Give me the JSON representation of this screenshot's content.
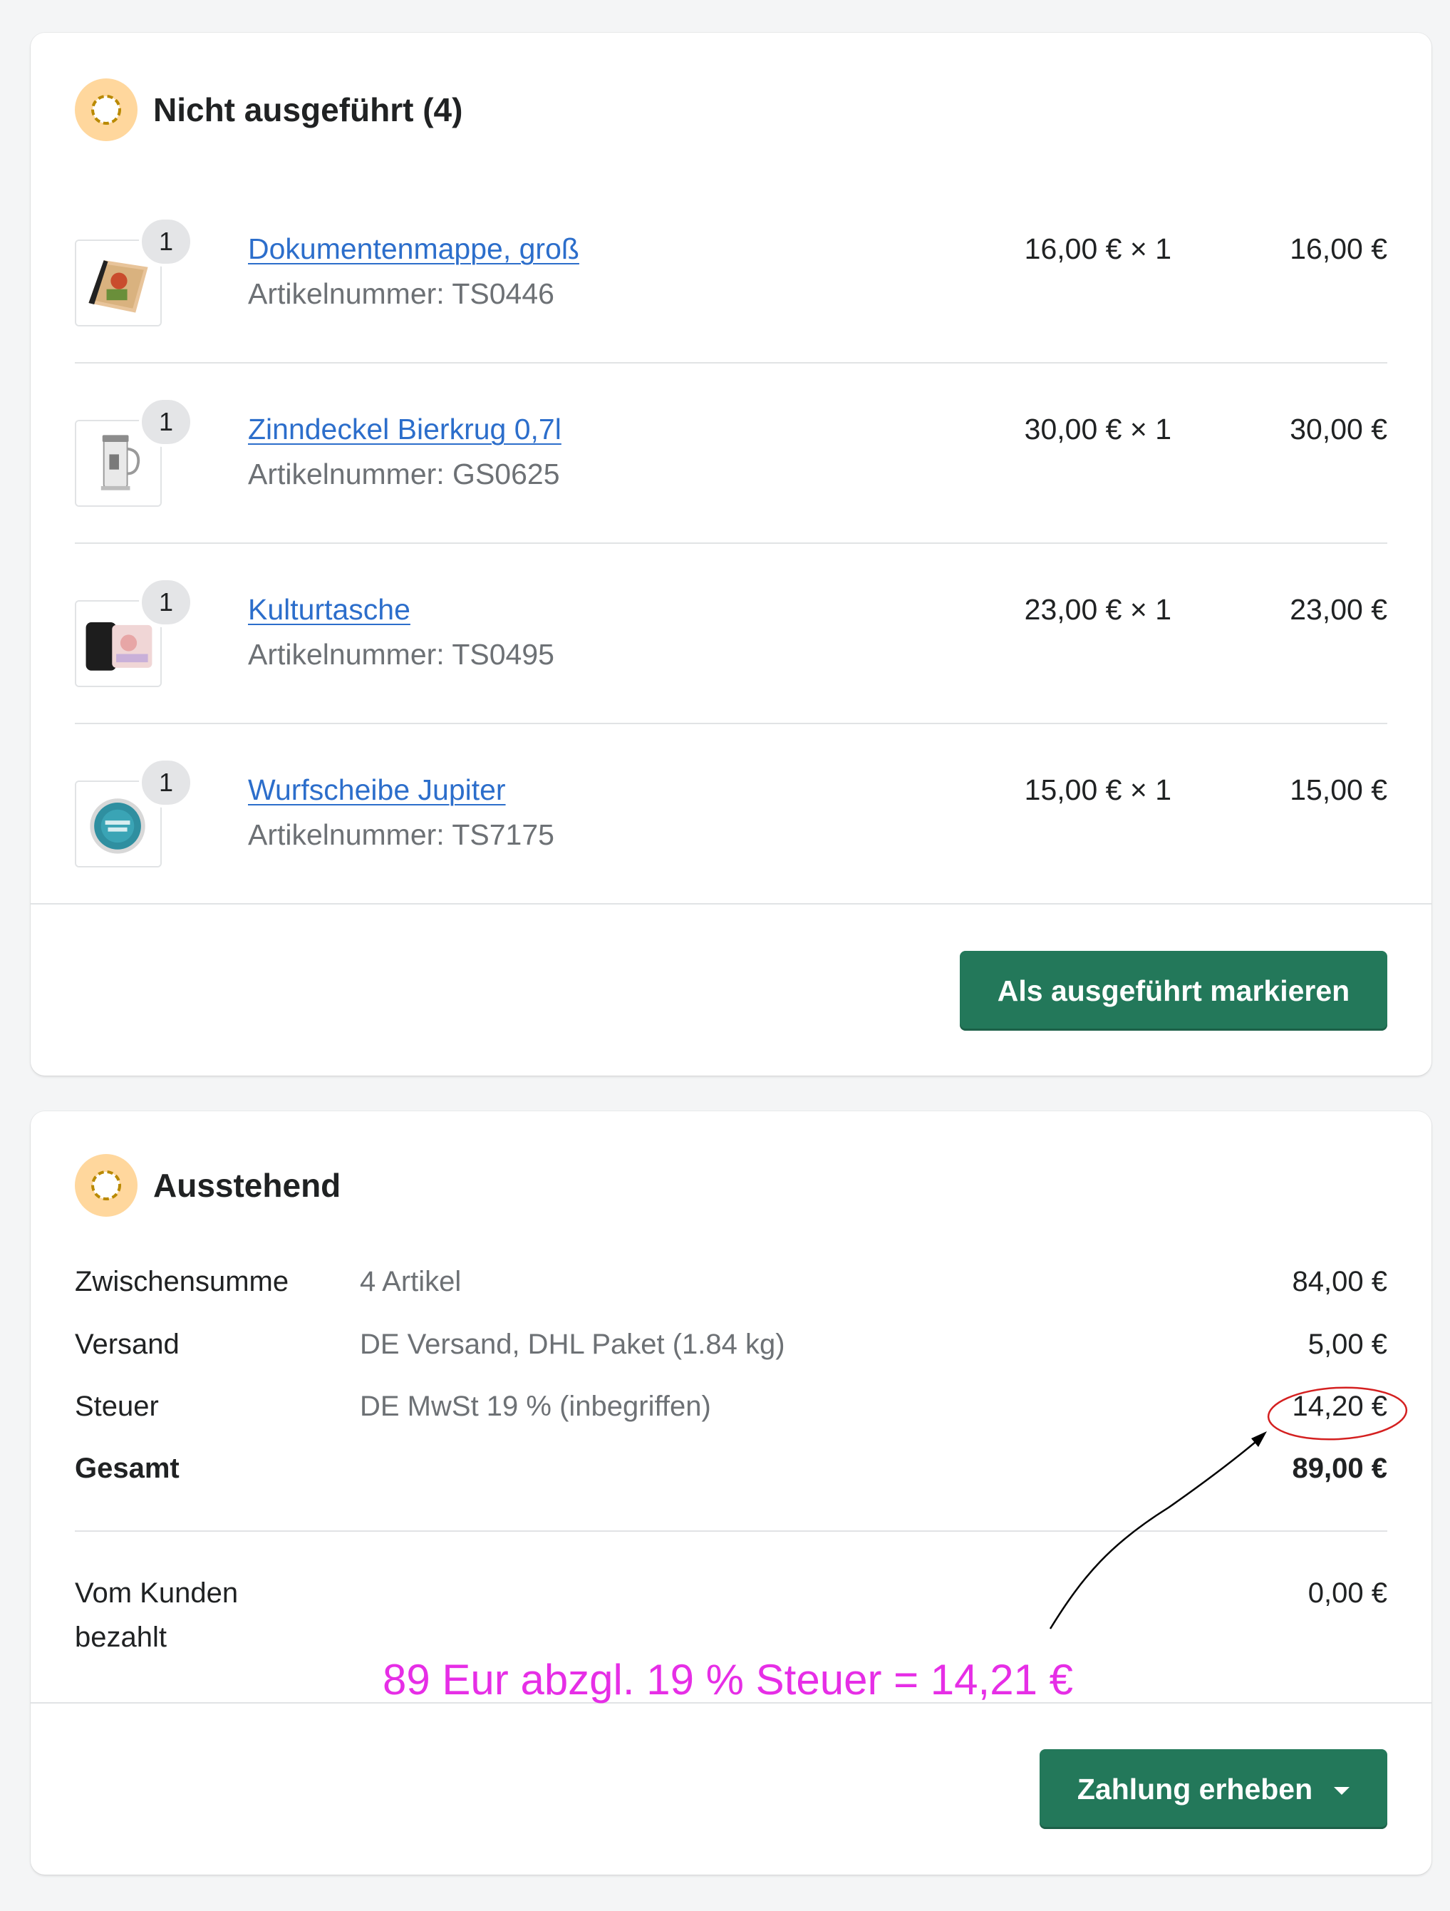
{
  "unfulfilled_card": {
    "title": "Nicht ausgeführt (4)",
    "items": [
      {
        "name": "Dokumentenmappe, groß",
        "sku": "Artikelnummer: TS0446",
        "quantity": "1",
        "price": "16,00 € × 1",
        "total": "16,00 €"
      },
      {
        "name": "Zinndeckel Bierkrug 0,7l",
        "sku": "Artikelnummer: GS0625",
        "quantity": "1",
        "price": "30,00 € × 1",
        "total": "30,00 €"
      },
      {
        "name": "Kulturtasche",
        "sku": "Artikelnummer: TS0495",
        "quantity": "1",
        "price": "23,00 € × 1",
        "total": "23,00 €"
      },
      {
        "name": "Wurfscheibe Jupiter",
        "sku": "Artikelnummer: TS7175",
        "quantity": "1",
        "price": "15,00 € × 1",
        "total": "15,00 €"
      }
    ],
    "fulfill_button_label": "Als ausgeführt markieren"
  },
  "payment_card": {
    "title": "Ausstehend",
    "rows": [
      {
        "label": "Zwischensumme",
        "desc": "4 Artikel",
        "value": "84,00 €"
      },
      {
        "label": "Versand",
        "desc": "DE Versand, DHL Paket (1.84 kg)",
        "value": "5,00 €"
      },
      {
        "label": "Steuer",
        "desc": "DE MwSt 19 % (inbegriffen)",
        "value": "14,20 €"
      },
      {
        "label": "Gesamt",
        "desc": "",
        "value": "89,00 €"
      }
    ],
    "paid_label": "Vom Kunden bezahlt",
    "paid_value": "0,00 €",
    "collect_button_label": "Zahlung erheben"
  },
  "annotation": {
    "text": "89 Eur abzgl. 19 % Steuer = 14,21 €",
    "text_color": "#e62ee6",
    "circle_color": "#d42020",
    "arrow_color": "#000000"
  },
  "colors": {
    "primary_button": "#23785a",
    "link": "#2c6ecb",
    "status_icon_bg": "#ffd79d"
  },
  "icons": {
    "status": "status-incomplete-icon",
    "caret": "caret-down-icon"
  }
}
